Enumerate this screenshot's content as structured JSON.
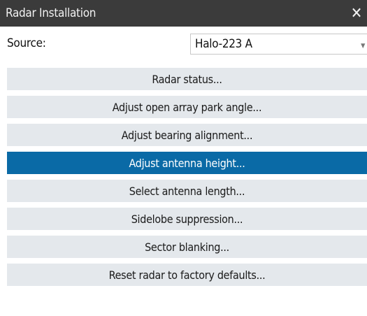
{
  "window": {
    "title": "Radar Installation",
    "close_glyph": "✕"
  },
  "source": {
    "label": "Source:",
    "value": "Halo-223 A"
  },
  "menu": {
    "items": [
      {
        "label": "Radar status...",
        "selected": false
      },
      {
        "label": "Adjust open array park angle...",
        "selected": false
      },
      {
        "label": "Adjust bearing alignment...",
        "selected": false
      },
      {
        "label": "Adjust antenna height...",
        "selected": true
      },
      {
        "label": "Select antenna length...",
        "selected": false
      },
      {
        "label": "Sidelobe suppression...",
        "selected": false
      },
      {
        "label": "Sector blanking...",
        "selected": false
      },
      {
        "label": "Reset radar to factory defaults...",
        "selected": false
      }
    ]
  },
  "colors": {
    "titlebar": "#3b3b3b",
    "item_bg": "#e4e8ec",
    "selected_bg": "#0a6aa6"
  }
}
